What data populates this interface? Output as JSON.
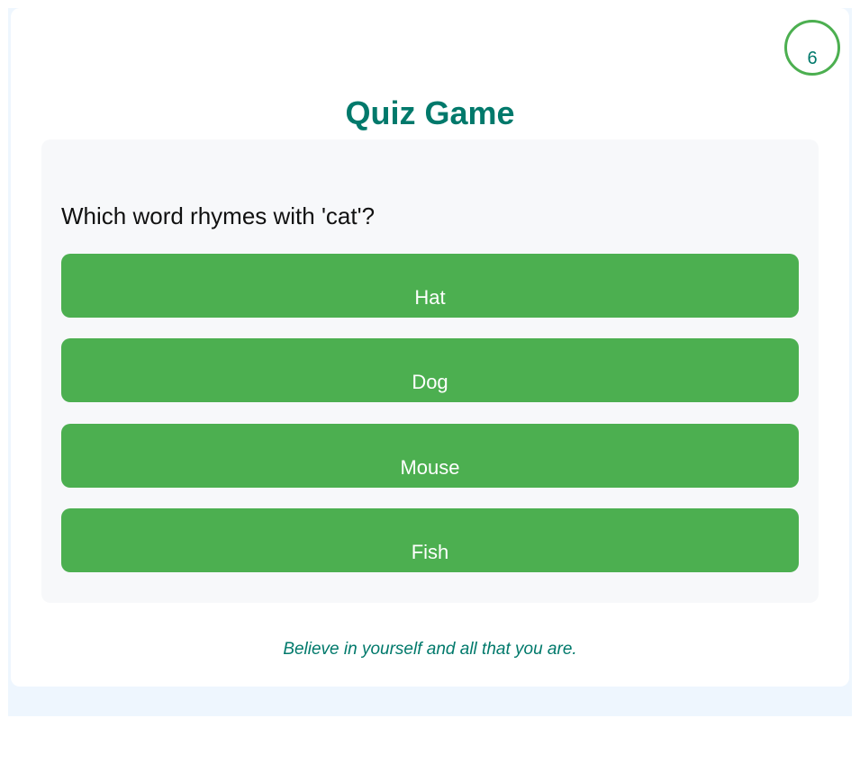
{
  "timer": {
    "value": "6"
  },
  "title": "Quiz Game",
  "question": "Which word rhymes with 'cat'?",
  "options": [
    "Hat",
    "Dog",
    "Mouse",
    "Fish"
  ],
  "footer": "Believe in yourself and all that you are.",
  "colors": {
    "accent": "#4caf50",
    "title": "#00796b",
    "background": "#eef6fe"
  }
}
